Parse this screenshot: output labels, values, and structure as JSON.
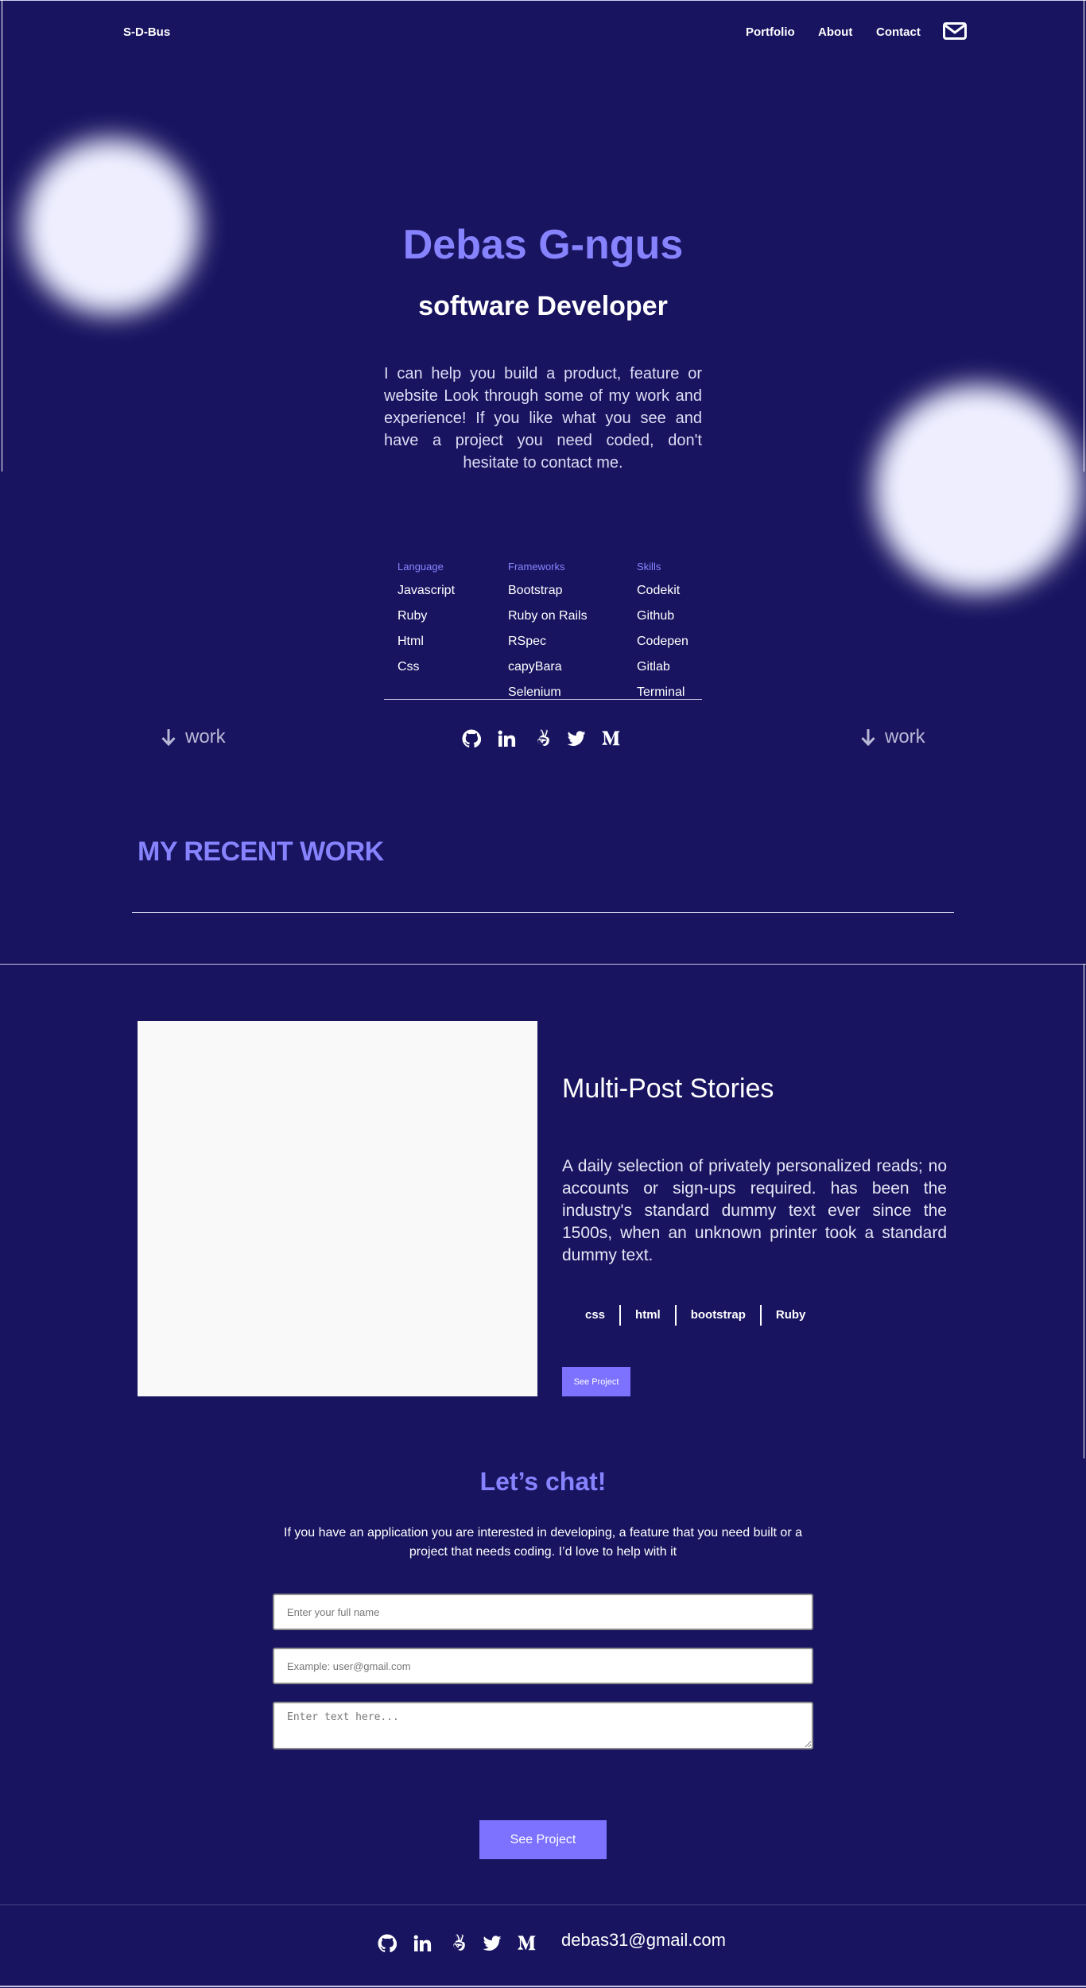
{
  "header": {
    "logo": "S-D-Bus",
    "nav": [
      "Portfolio",
      "About",
      "Contact"
    ],
    "mail_icon": "envelope-icon"
  },
  "hero": {
    "name": "Debas G-ngus",
    "role": "software Developer",
    "intro": "I can help you build a product, feature or website Look through some of my work and experience! If you like what you see and have a project you need coded, don't hesitate to contact me."
  },
  "skills": {
    "language": {
      "title": "Language",
      "items": [
        "Javascript",
        "Ruby",
        "Html",
        "Css"
      ]
    },
    "frameworks": {
      "title": "Frameworks",
      "items": [
        "Bootstrap",
        "Ruby on Rails",
        "RSpec",
        "capyBara",
        "Selenium"
      ]
    },
    "tools": {
      "title": "Skills",
      "items": [
        "Codekit",
        "Github",
        "Codepen",
        "Gitlab",
        "Terminal"
      ]
    }
  },
  "work_links": {
    "left": "work",
    "right": "work"
  },
  "social_icons": [
    "github-icon",
    "linkedin-icon",
    "angellist-icon",
    "twitter-icon",
    "medium-icon"
  ],
  "recent": {
    "title": "MY RECENT WORK"
  },
  "project": {
    "title": "Multi-Post Stories",
    "description": "A daily selection of privately personalized reads; no accounts or sign-ups required. has been the industry's standard dummy text ever since the 1500s, when an unknown printer took a standard dummy text.",
    "tags": [
      "css",
      "html",
      "bootstrap",
      "Ruby"
    ],
    "button": "See Project"
  },
  "chat": {
    "title": "Let’s chat!",
    "text": "If you have an application you are interested in developing, a feature that you need built or a project that needs coding. I’d love to help with it",
    "name_placeholder": "Enter your full name",
    "email_placeholder": "Example: user@gmail.com",
    "message_placeholder": "Enter text here...",
    "button": "See Project"
  },
  "footer": {
    "email": "debas31@gmail.com"
  },
  "colors": {
    "background": "#181460",
    "accent": "#8783ff",
    "button": "#7c72ff"
  }
}
